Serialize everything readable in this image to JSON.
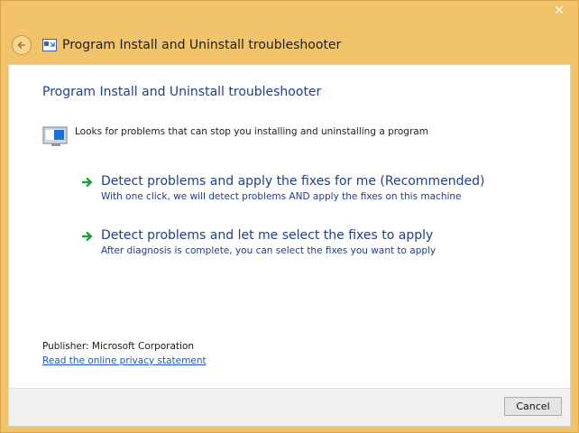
{
  "window": {
    "close_glyph": "✕",
    "title": "Program Install and Uninstall troubleshooter",
    "frame_color": "#f1c46b"
  },
  "content": {
    "heading": "Program Install and Uninstall troubleshooter",
    "description": "Looks for problems that can stop you installing and uninstalling a program",
    "options": [
      {
        "title": "Detect problems and apply the fixes for me (Recommended)",
        "subtitle": "With one click, we will detect problems AND apply the fixes on this machine",
        "icon": "green-arrow-icon"
      },
      {
        "title": "Detect problems and let me select the fixes to apply",
        "subtitle": "After diagnosis is complete, you can select the fixes you want to apply",
        "icon": "green-arrow-icon"
      }
    ],
    "publisher": "Publisher: Microsoft Corporation",
    "privacy_link": "Read the online privacy statement",
    "accent_color": "#1e3f8f",
    "link_color": "#1d56c9"
  },
  "footer": {
    "cancel_label": "Cancel"
  }
}
